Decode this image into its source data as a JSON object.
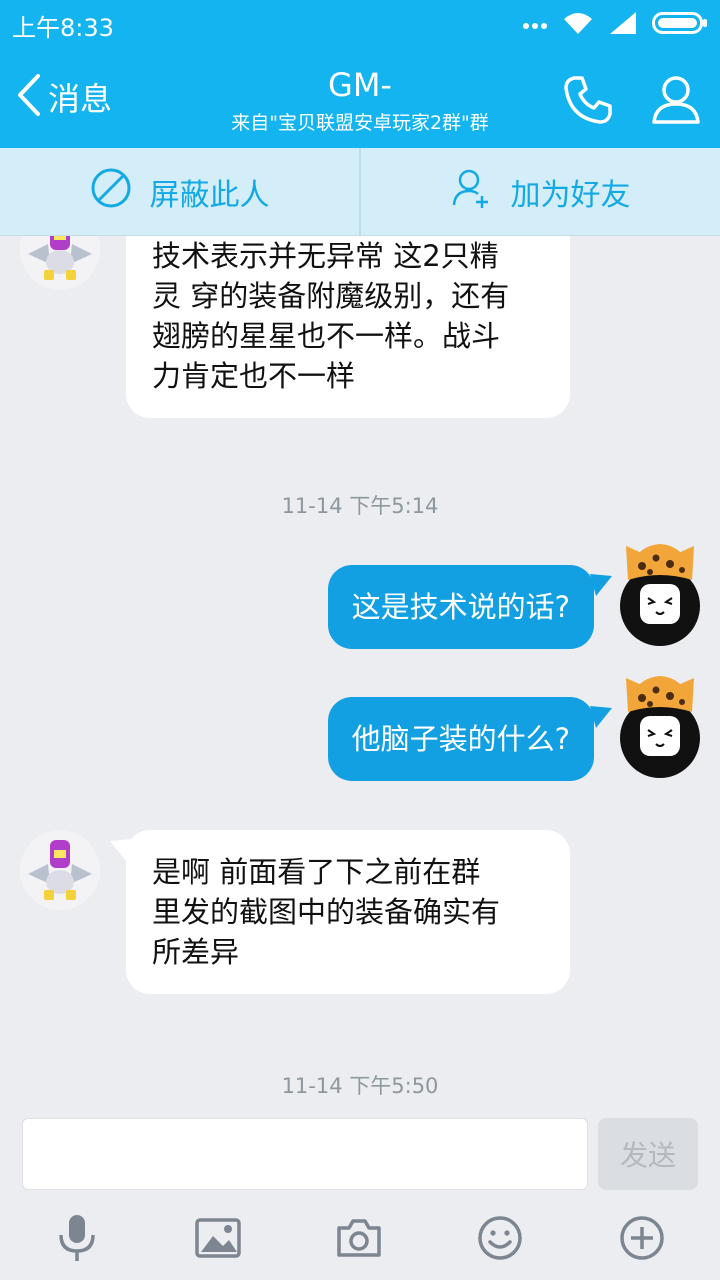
{
  "status": {
    "time": "上午8:33"
  },
  "header": {
    "back_label": "消息",
    "title": "GM-",
    "subtitle": "来自\"宝贝联盟安卓玩家2群\"群"
  },
  "actions": {
    "block_label": "屏蔽此人",
    "add_friend_label": "加为好友"
  },
  "messages": [
    {
      "from": "other",
      "lines": [
        "技术表示并无异常 这2只精",
        "灵 穿的装备附魔级别，还有",
        "翅膀的星星也不一样。战斗",
        "力肯定也不一样"
      ]
    },
    {
      "timestamp": "11-14 下午5:14"
    },
    {
      "from": "me",
      "text": "这是技术说的话?"
    },
    {
      "from": "me",
      "text": "他脑子装的什么?"
    },
    {
      "from": "other",
      "lines": [
        "是啊  前面看了下之前在群",
        "里发的截图中的装备确实有",
        "所差异"
      ]
    },
    {
      "timestamp": "11-14 下午5:50"
    }
  ],
  "input": {
    "value": "",
    "send_label": "发送"
  },
  "toolbar": [
    "mic-icon",
    "image-icon",
    "camera-icon",
    "emoji-icon",
    "plus-icon"
  ],
  "colors": {
    "primary": "#13b4ef",
    "bubble_out": "#12a0e3",
    "bubble_in": "#ffffff",
    "background": "#ebedf0"
  }
}
